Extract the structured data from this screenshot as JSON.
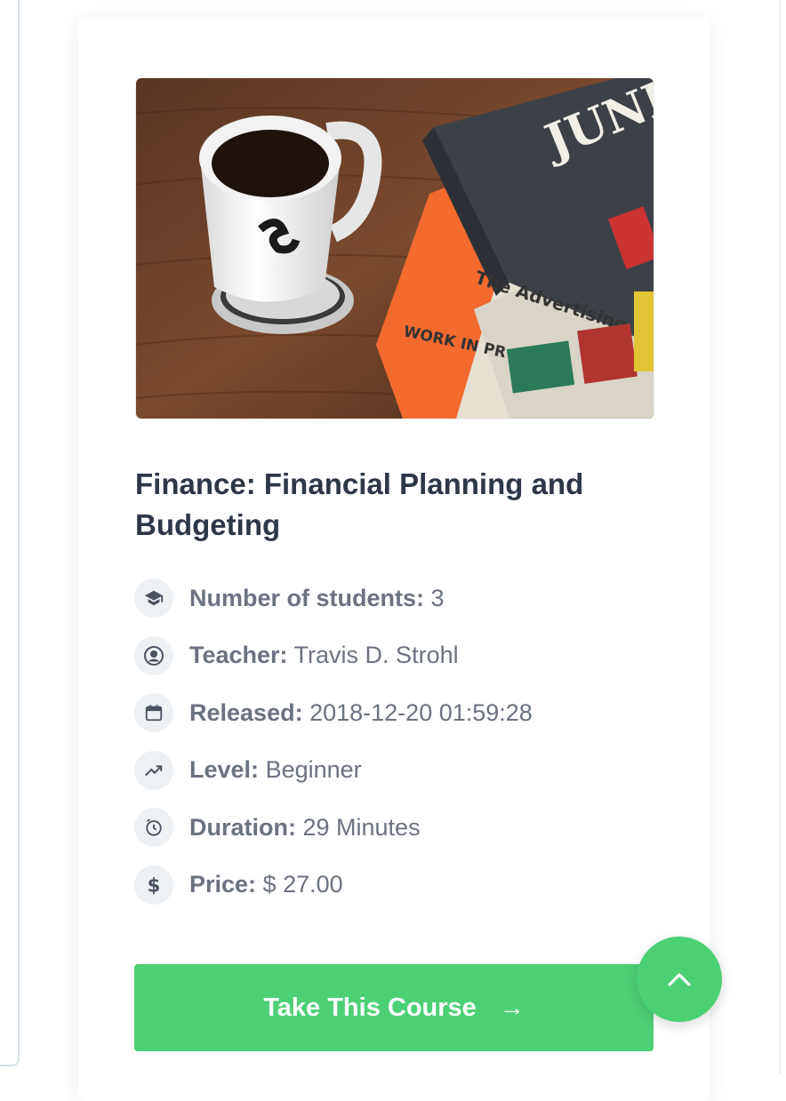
{
  "course": {
    "title": "Finance: Financial Planning and Budgeting",
    "image": {
      "book_text_1": "JUNK",
      "book_text_2": "The Advertising",
      "book_text_3": "WORK IN PR"
    },
    "meta": [
      {
        "icon": "graduation-cap-icon",
        "label": "Number of students:",
        "value": "3"
      },
      {
        "icon": "user-circle-icon",
        "label": "Teacher:",
        "value": "Travis D. Strohl"
      },
      {
        "icon": "calendar-icon",
        "label": "Released:",
        "value": "2018-12-20 01:59:28"
      },
      {
        "icon": "trending-up-icon",
        "label": "Level:",
        "value": "Beginner"
      },
      {
        "icon": "clock-icon",
        "label": "Duration:",
        "value": "29 Minutes"
      },
      {
        "icon": "dollar-icon",
        "label": "Price:",
        "value": "$ 27.00"
      }
    ],
    "cta_label": "Take This Course",
    "cta_arrow": "→"
  },
  "colors": {
    "accent": "#4cd074",
    "title": "#2d3748",
    "meta_text": "#6b7280",
    "icon_bg": "#eef1f4"
  }
}
